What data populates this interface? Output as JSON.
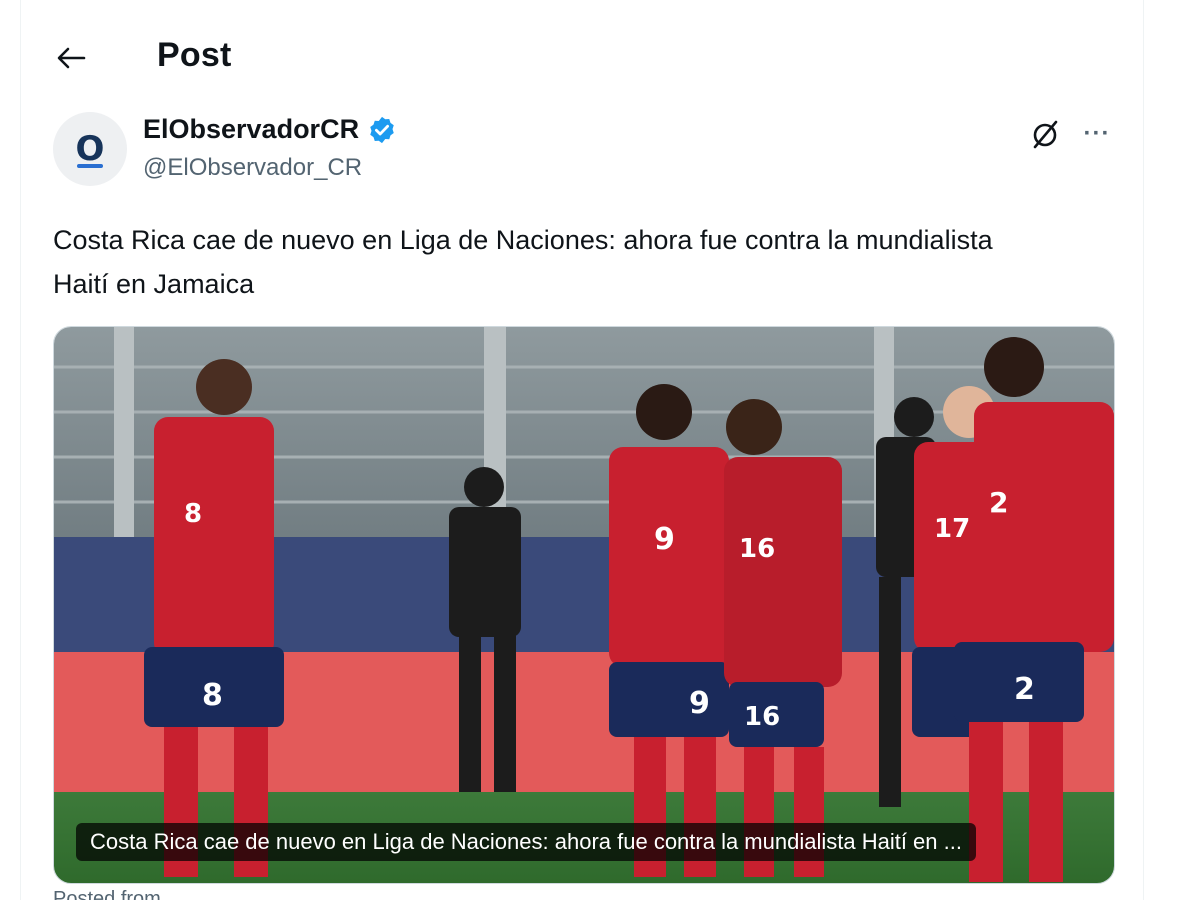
{
  "header": {
    "title": "Post",
    "back_icon": "arrow-left-icon"
  },
  "author": {
    "avatar_letter": "O",
    "display_name": "ElObservadorCR",
    "handle": "@ElObservador_CR",
    "verified": true,
    "verified_color": "#1d9bf0"
  },
  "actions": {
    "grok_icon": "grok-icon",
    "more_label": "···"
  },
  "post": {
    "text": "Costa Rica cae de nuevo en Liga de Naciones: ahora fue contra la mundialista Haití en Jamaica"
  },
  "media": {
    "caption": "Costa Rica cae de nuevo en Liga de Naciones: ahora fue contra la mundialista Haití en ...",
    "players": [
      {
        "number": "8"
      },
      {
        "number": "9"
      },
      {
        "number": "16"
      },
      {
        "number": "17"
      },
      {
        "number": "2"
      }
    ]
  },
  "footer": {
    "cut_text": "Posted from"
  },
  "colors": {
    "text_primary": "#0f1419",
    "text_secondary": "#536471",
    "jersey_red": "#c8202f",
    "shorts_navy": "#1a2a5a"
  }
}
